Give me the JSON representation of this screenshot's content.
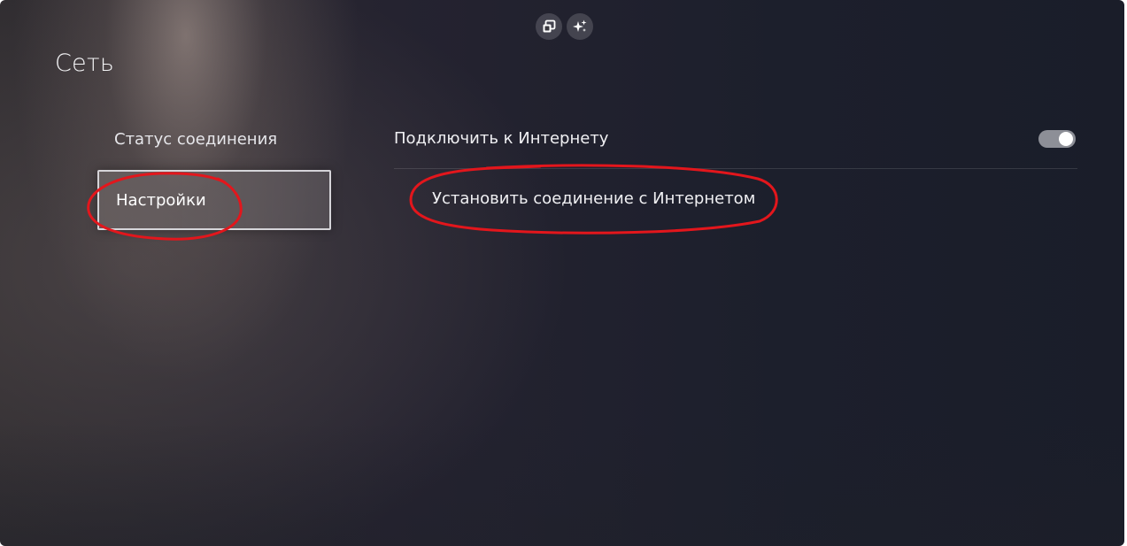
{
  "header": {
    "title": "Сеть",
    "icons": [
      "picture-in-picture-icon",
      "sparkle-icon"
    ]
  },
  "left_menu": {
    "items": [
      {
        "label": "Статус соединения",
        "selected": false
      },
      {
        "label": "Настройки",
        "selected": true
      }
    ]
  },
  "settings": {
    "connect_internet": {
      "label": "Подключить к Интернету",
      "toggle_on": true
    },
    "setup_connection": {
      "label": "Установить соединение с Интернетом"
    }
  },
  "colors": {
    "annotation": "#e3161c",
    "toggle_track": "#8d8f97",
    "selected_border": "#ebebf0"
  }
}
